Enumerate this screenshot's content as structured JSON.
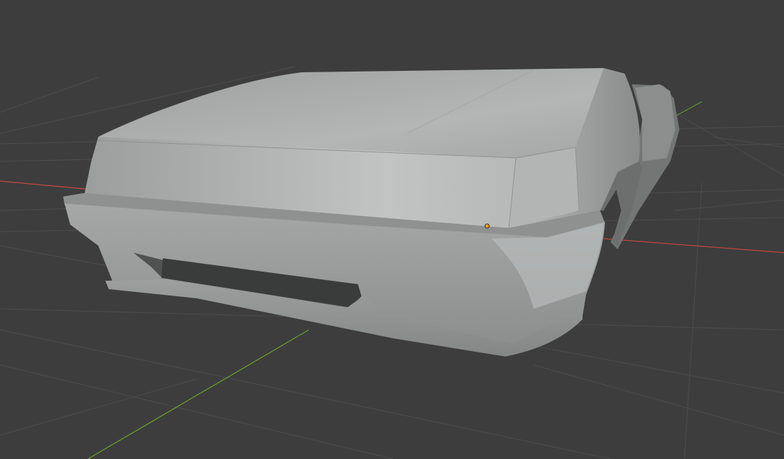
{
  "viewport": {
    "background_color": "#3d3d3d",
    "grid_color": "#4c4c4c",
    "x_axis_color": "#c0473f",
    "y_axis_color": "#6a9a32",
    "object_color": "#a9acab",
    "origin_color": "#f5a020",
    "icons": [
      "origin-point-icon"
    ]
  }
}
